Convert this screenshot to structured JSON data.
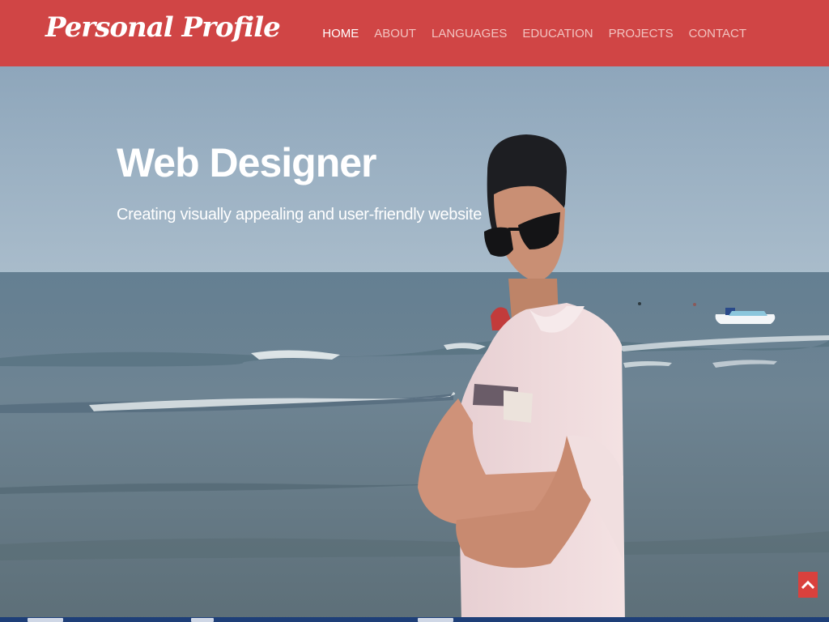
{
  "brand": {
    "title": "Personal Profile"
  },
  "nav": {
    "items": [
      {
        "label": "HOME",
        "active": true
      },
      {
        "label": "ABOUT",
        "active": false
      },
      {
        "label": "LANGUAGES",
        "active": false
      },
      {
        "label": "EDUCATION",
        "active": false
      },
      {
        "label": "PROJECTS",
        "active": false
      },
      {
        "label": "CONTACT",
        "active": false
      }
    ]
  },
  "hero": {
    "title": "Web Designer",
    "subtitle": "Creating visually appealing and user-friendly website",
    "photo": "man-with-sunglasses-at-beach"
  },
  "back_to_top": {
    "icon": "chevron-up-icon"
  },
  "colors": {
    "navbar": "#d04545",
    "nav_active": "#ffffff",
    "nav_inactive": "#f2c3c0",
    "back_to_top": "#d9413d"
  }
}
